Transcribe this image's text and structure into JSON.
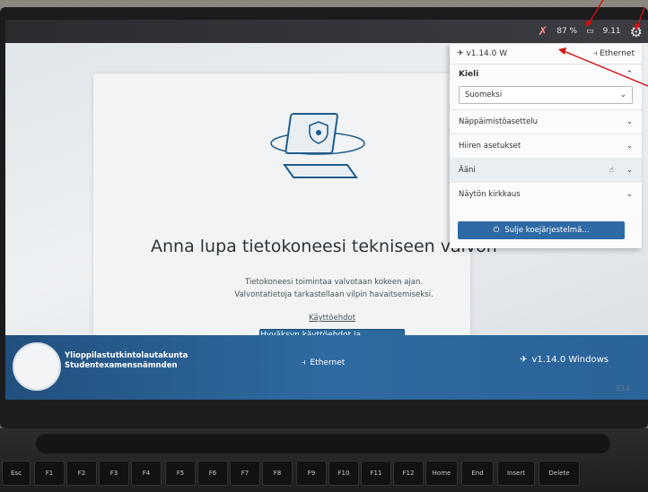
{
  "topbar": {
    "battery": "87 %",
    "time": "9.11",
    "network_icon": "network-disconnected-icon",
    "settings_icon": "gear-icon"
  },
  "dialog": {
    "title": "Anna lupa tietokoneesi tekniseen valvon",
    "body_line1": "Tietokoneesi toimintaa valvotaan kokeen ajan.",
    "body_line2": "Valvontatietoja tarkastellaan vilpin havaitsemiseksi.",
    "terms_link": "Käyttöehdot",
    "accept_button": "Hyväksyn käyttöehdot ja valvonnan"
  },
  "footer": {
    "org_fi": "Ylioppilastutkintolautakunta",
    "org_sv": "Studentexamensnämnden",
    "ethernet": "Ethernet",
    "version": "v1.14.0 Windows"
  },
  "panel": {
    "version": "v1.14.0 W",
    "ethernet": "Ethernet",
    "language_label": "Kieli",
    "language_value": "Suomeksi",
    "rows": [
      "Näppäimistöasettelu",
      "Hiiren asetukset",
      "Ääni",
      "Näytön kirkkaus"
    ],
    "shutdown": "Sulje koejärjestelmä..."
  },
  "device": {
    "model": "E14"
  },
  "keyboard": {
    "keys": [
      "Esc",
      "F1",
      "F2",
      "F3",
      "F4",
      "F5",
      "F6",
      "F7",
      "F8",
      "F9",
      "F10",
      "F11",
      "F12",
      "Home",
      "End",
      "Insert",
      "Delete"
    ]
  },
  "colors": {
    "accent": "#2a6a9c",
    "footer": "#2b6399",
    "annotation": "#d11010"
  }
}
